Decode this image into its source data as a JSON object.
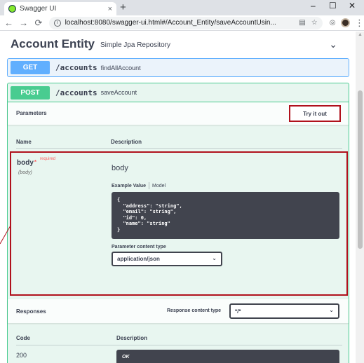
{
  "browser": {
    "tab_title": "Swagger UI",
    "tab_close": "×",
    "new_tab": "+",
    "url": "localhost:8080/swagger-ui.html#/Account_Entity/saveAccountUsin...",
    "window_controls": {
      "minimize": "–",
      "maximize": "☐",
      "close": "✕"
    },
    "nav": {
      "back": "←",
      "forward": "→",
      "reload": "⟳"
    },
    "info_glyph": "i"
  },
  "section": {
    "title": "Account Entity",
    "description": "Simple Jpa Repository",
    "chevron": "⌄"
  },
  "get_op": {
    "method": "GET",
    "path": "/accounts",
    "summary": "findAllAccount"
  },
  "post_op": {
    "method": "POST",
    "path": "/accounts",
    "summary": "saveAccount",
    "parameters_title": "Parameters",
    "try_it_out": "Try it out",
    "col_name": "Name",
    "col_description": "Description",
    "param": {
      "name": "body",
      "star": "*",
      "required": "required",
      "in": "(body)",
      "description": "body",
      "example_tab": "Example Value",
      "model_tab": "Model",
      "example_code": "{\n  \"address\": \"string\",\n  \"email\": \"string\",\n  \"id\": 0,\n  \"name\": \"string\"\n}",
      "content_type_label": "Parameter content type",
      "content_type_value": "application/json"
    },
    "responses": {
      "title": "Responses",
      "content_type_label": "Response content type",
      "content_type_value": "*/*",
      "code_header": "Code",
      "description_header": "Description",
      "rows": [
        {
          "code": "200",
          "description": "OK"
        }
      ]
    }
  },
  "colors": {
    "get": "#61affe",
    "post": "#49cc90",
    "highlight": "#b0111c"
  }
}
